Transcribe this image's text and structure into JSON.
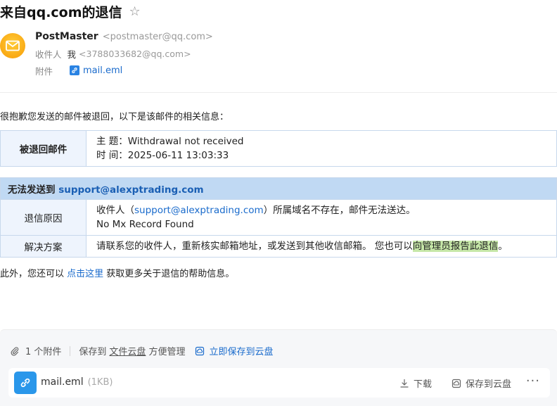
{
  "header": {
    "title": "来自qq.com的退信",
    "star_icon": "star-icon"
  },
  "sender": {
    "name": "PostMaster",
    "email": "<postmaster@qq.com>",
    "recipient_label": "收件人",
    "recipient_name": "我",
    "recipient_email": "<3788033682@qq.com>",
    "attachment_label": "附件",
    "attachment_name": "mail.eml"
  },
  "body": {
    "intro": "很抱歉您发送的邮件被退回，以下是该邮件的相关信息：",
    "bounced": {
      "label": "被退回邮件",
      "subject_label": "主 题：",
      "subject": "Withdrawal not received",
      "time_label": "时 间：",
      "time": "2025-06-11 13:03:33"
    },
    "failure": {
      "header_prefix": "无法发送到 ",
      "address": "support@alexptrading.com",
      "reason_label": "退信原因",
      "reason_prefix": "收件人（",
      "reason_address": "support@alexptrading.com",
      "reason_suffix": "）所属域名不存在，邮件无法送达。",
      "reason_detail": "No Mx Record Found",
      "solution_label": "解决方案",
      "solution_text": "请联系您的收件人，重新核实邮箱地址，或发送到其他收信邮箱。 您也可以",
      "solution_link": "向管理员报告此退信",
      "solution_end": "。"
    },
    "footer_prefix": "此外，您还可以 ",
    "footer_link": "点击这里",
    "footer_suffix": " 获取更多关于退信的帮助信息。"
  },
  "attachments_panel": {
    "count_text": "1 个附件",
    "save_prefix": "保存到",
    "cloud_link": "文件云盘",
    "save_suffix": "方便管理",
    "save_now": "立即保存到云盘",
    "file": {
      "name": "mail.eml",
      "size": "(1KB)",
      "download": "下载",
      "save_cloud": "保存到云盘",
      "more": "···"
    }
  }
}
